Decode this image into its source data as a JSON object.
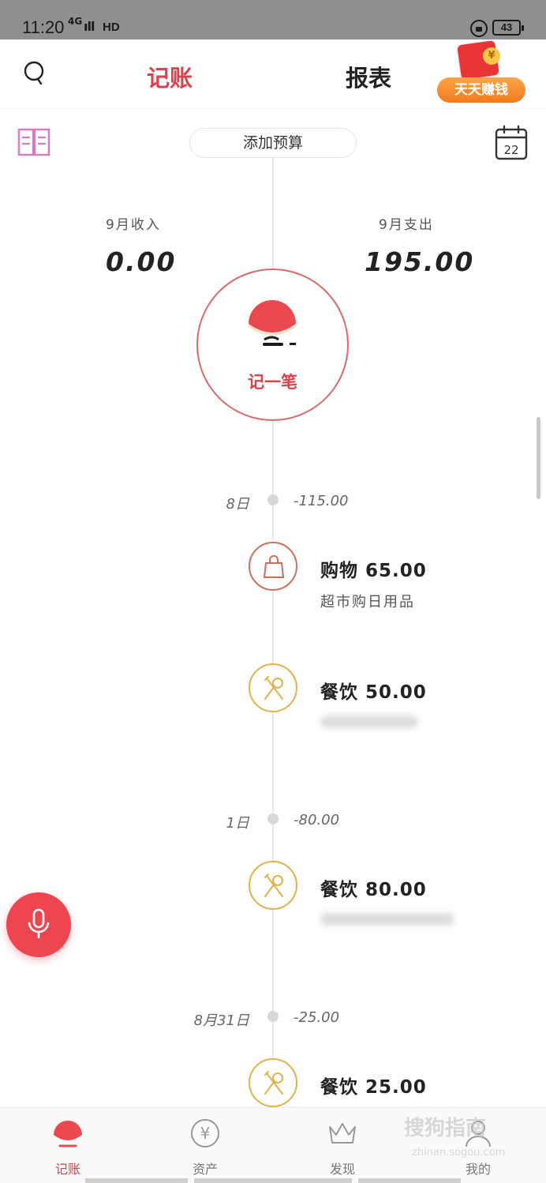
{
  "status_bar": {
    "time": "11:20",
    "network": "4G",
    "signal": "ıll",
    "hd": "HD",
    "battery": "43"
  },
  "header": {
    "tabs": [
      {
        "label": "记账",
        "active": true
      },
      {
        "label": "报表",
        "active": false
      }
    ],
    "promo_label": "天天赚钱",
    "promo_coin": "¥"
  },
  "toolbar": {
    "budget_label": "添加预算",
    "calendar_day": "22"
  },
  "summary": {
    "income_label": "9月收入",
    "income_value": "0.00",
    "expense_label": "9月支出",
    "expense_value": "195.00"
  },
  "record_button": {
    "label": "记一笔"
  },
  "days": [
    {
      "date": "8日",
      "total": "-115.00"
    },
    {
      "date": "1日",
      "total": "-80.00"
    },
    {
      "date": "8月31日",
      "total": "-25.00"
    }
  ],
  "entries": [
    {
      "category": "购物",
      "amount": "65.00",
      "title": "购物 65.00",
      "note": "超市购日用品",
      "icon": "shopping-bag-icon"
    },
    {
      "category": "餐饮",
      "amount": "50.00",
      "title": "餐饮 50.00",
      "note": "",
      "icon": "dining-icon"
    },
    {
      "category": "餐饮",
      "amount": "80.00",
      "title": "餐饮 80.00",
      "note": "",
      "icon": "dining-icon"
    },
    {
      "category": "餐饮",
      "amount": "25.00",
      "title": "餐饮 25.00",
      "note": "",
      "icon": "dining-icon"
    }
  ],
  "bottom_nav": [
    {
      "label": "记账",
      "active": true
    },
    {
      "label": "资产",
      "active": false,
      "icon_glyph": "¥"
    },
    {
      "label": "发现",
      "active": false
    },
    {
      "label": "我的",
      "active": false
    }
  ],
  "watermark": {
    "text": "搜狗指南",
    "sub": "zhinan.sogou.com"
  },
  "colors": {
    "accent": "#d9434b",
    "shopping": "#c9705a",
    "dining": "#e0b24a",
    "mic": "#ee4550",
    "promo": "#ef7b1d"
  }
}
